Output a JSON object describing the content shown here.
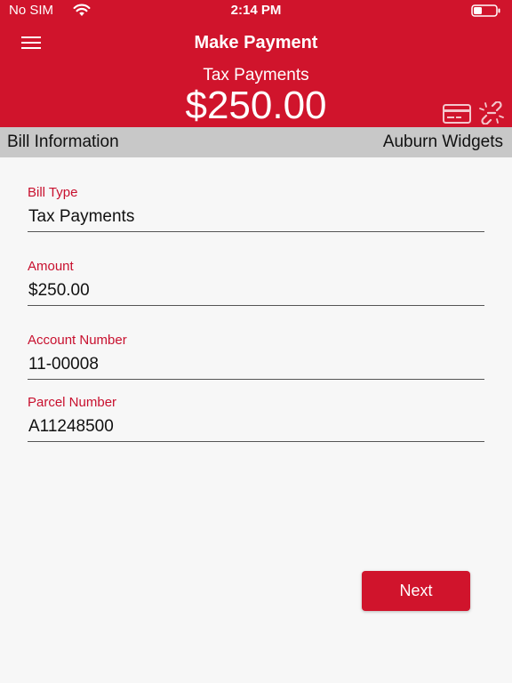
{
  "status_bar": {
    "carrier": "No SIM",
    "time": "2:14 PM",
    "wifi_icon": "wifi-icon",
    "battery_icon": "battery-icon"
  },
  "nav": {
    "title": "Make Payment",
    "menu_icon": "hamburger-menu-icon"
  },
  "summary": {
    "bill_type": "Tax Payments",
    "amount": "$250.00",
    "card_icon": "credit-card-icon",
    "unlink_icon": "unlink-icon"
  },
  "info_bar": {
    "left": "Bill Information",
    "right": "Auburn Widgets"
  },
  "form": {
    "bill_type": {
      "label": "Bill Type",
      "value": "Tax Payments"
    },
    "amount": {
      "label": "Amount",
      "value": "$250.00"
    },
    "account_number": {
      "label": "Account Number",
      "value": "11-00008"
    },
    "parcel_number": {
      "label": "Parcel Number",
      "value": "A11248500"
    }
  },
  "actions": {
    "next_label": "Next"
  },
  "colors": {
    "brand_red": "#d0142c",
    "label_red": "#c8102e",
    "info_bar_gray": "#c8c8c8",
    "background": "#f7f7f7"
  }
}
